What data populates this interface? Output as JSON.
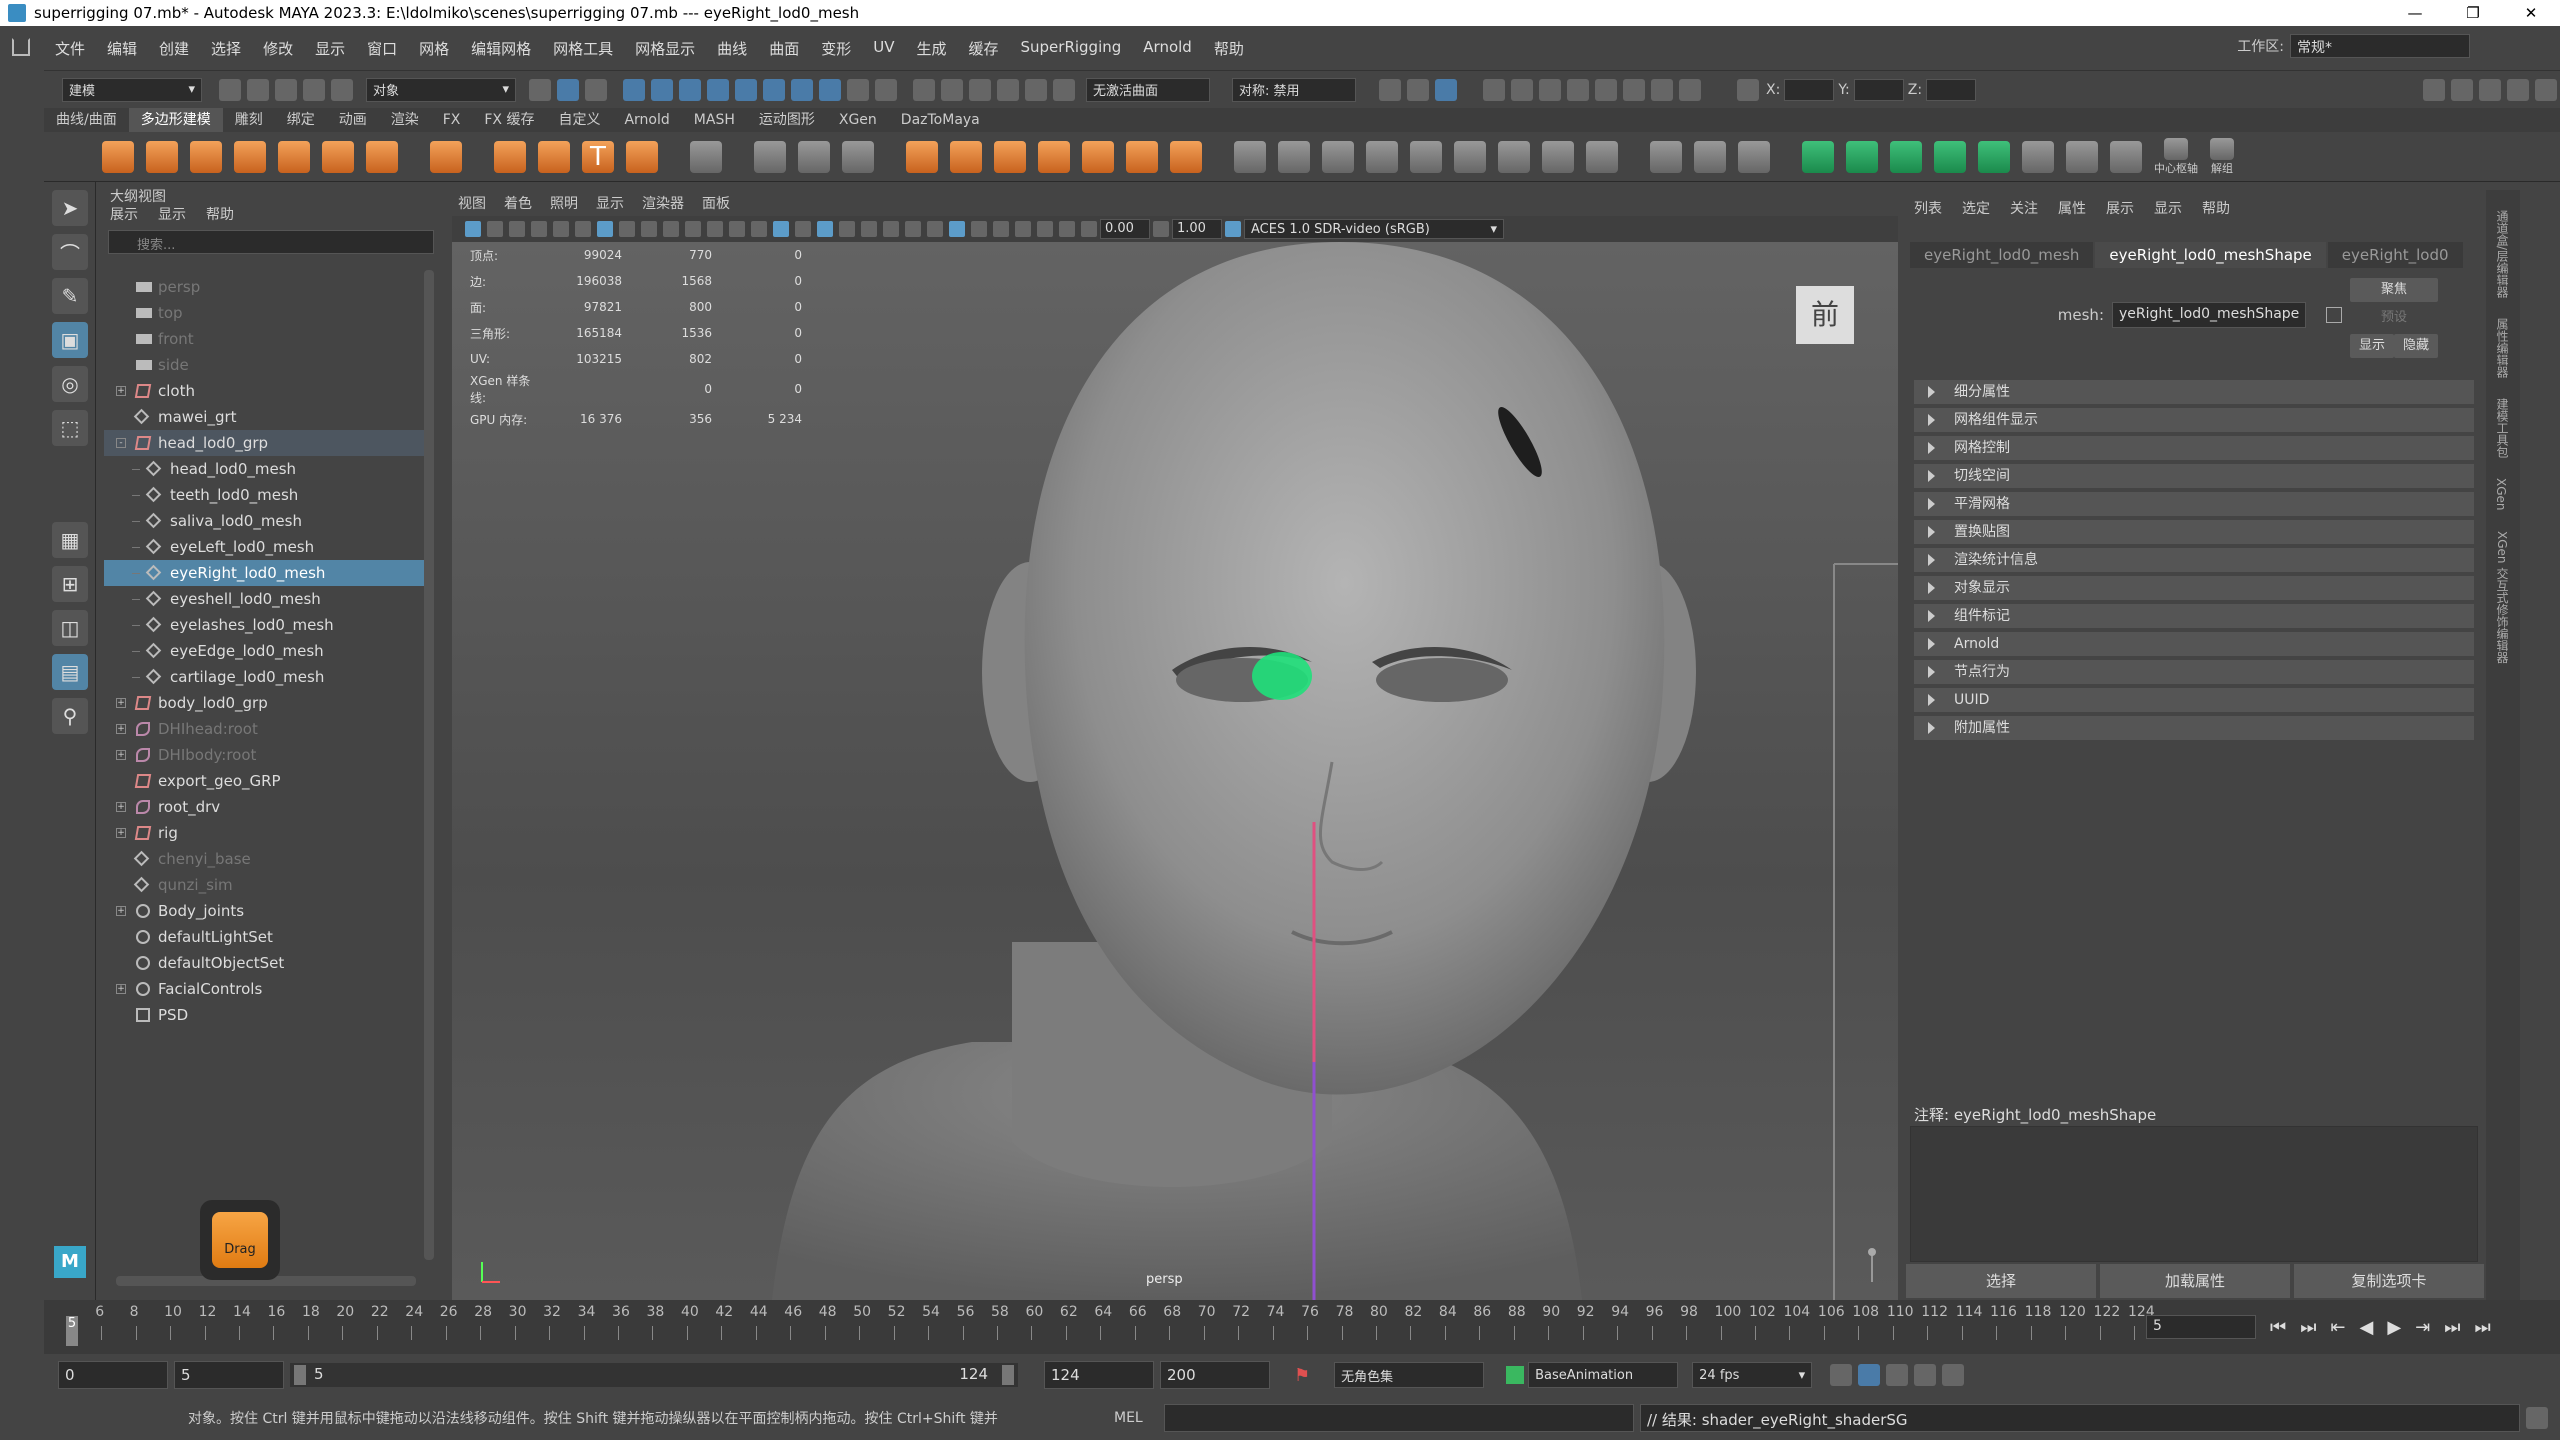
{
  "window": {
    "title": "superrigging 07.mb* - Autodesk MAYA 2023.3: E:\\ldolmiko\\scenes\\superrigging 07.mb  ---  eyeRight_lod0_mesh"
  },
  "menubar": {
    "items": [
      "文件",
      "编辑",
      "创建",
      "选择",
      "修改",
      "显示",
      "窗口",
      "网格",
      "编辑网格",
      "网格工具",
      "网格显示",
      "曲线",
      "曲面",
      "变形",
      "UV",
      "生成",
      "缓存",
      "SuperRigging",
      "Arnold",
      "帮助"
    ],
    "workspace_label": "工作区:",
    "workspace_value": "常规*"
  },
  "statusline": {
    "mode": "建模",
    "object_label": "对象",
    "live_surface": "无激活曲面",
    "symmetry": "对称: 禁用",
    "x_label": "X:",
    "y_label": "Y:",
    "z_label": "Z:"
  },
  "shelf": {
    "tabs": [
      "曲线/曲面",
      "多边形建模",
      "雕刻",
      "绑定",
      "动画",
      "渲染",
      "FX",
      "FX 缓存",
      "自定义",
      "Arnold",
      "MASH",
      "运动图形",
      "XGen",
      "DazToMaya"
    ],
    "active_tab": "多边形建模",
    "center_pivot": "中心枢轴",
    "ungroup": "解组"
  },
  "outliner": {
    "title": "大纲视图",
    "menu": [
      "展示",
      "显示",
      "帮助"
    ],
    "search_placeholder": "搜索...",
    "items": [
      {
        "label": "persp",
        "icon": "cam",
        "indent": 0,
        "dim": true
      },
      {
        "label": "top",
        "icon": "cam",
        "indent": 0,
        "dim": true
      },
      {
        "label": "front",
        "icon": "cam",
        "indent": 0,
        "dim": true
      },
      {
        "label": "side",
        "icon": "cam",
        "indent": 0,
        "dim": true
      },
      {
        "label": "cloth",
        "icon": "grp",
        "indent": 0,
        "exp": "+"
      },
      {
        "label": "mawei_grt",
        "icon": "mesh",
        "indent": 0
      },
      {
        "label": "head_lod0_grp",
        "icon": "grp",
        "indent": 0,
        "exp": "-",
        "hl": true
      },
      {
        "label": "head_lod0_mesh",
        "icon": "mesh",
        "indent": 1
      },
      {
        "label": "teeth_lod0_mesh",
        "icon": "mesh",
        "indent": 1
      },
      {
        "label": "saliva_lod0_mesh",
        "icon": "mesh",
        "indent": 1
      },
      {
        "label": "eyeLeft_lod0_mesh",
        "icon": "mesh",
        "indent": 1
      },
      {
        "label": "eyeRight_lod0_mesh",
        "icon": "mesh",
        "indent": 1,
        "sel": true
      },
      {
        "label": "eyeshell_lod0_mesh",
        "icon": "mesh",
        "indent": 1
      },
      {
        "label": "eyelashes_lod0_mesh",
        "icon": "mesh",
        "indent": 1
      },
      {
        "label": "eyeEdge_lod0_mesh",
        "icon": "mesh",
        "indent": 1
      },
      {
        "label": "cartilage_lod0_mesh",
        "icon": "mesh",
        "indent": 1
      },
      {
        "label": "body_lod0_grp",
        "icon": "grp",
        "indent": 0,
        "exp": "+"
      },
      {
        "label": "DHIhead:root",
        "icon": "joint",
        "indent": 0,
        "exp": "+",
        "dim": true
      },
      {
        "label": "DHIbody:root",
        "icon": "joint",
        "indent": 0,
        "exp": "+",
        "dim": true
      },
      {
        "label": "export_geo_GRP",
        "icon": "grp",
        "indent": 0
      },
      {
        "label": "root_drv",
        "icon": "joint",
        "indent": 0,
        "exp": "+"
      },
      {
        "label": "rig",
        "icon": "grp",
        "indent": 0,
        "exp": "+"
      },
      {
        "label": "chenyi_base",
        "icon": "mesh",
        "indent": 0,
        "dim": true
      },
      {
        "label": "qunzi_sim",
        "icon": "mesh",
        "indent": 0,
        "dim": true
      },
      {
        "label": "Body_joints",
        "icon": "set",
        "indent": 0,
        "exp": "+"
      },
      {
        "label": "defaultLightSet",
        "icon": "set",
        "indent": 0
      },
      {
        "label": "defaultObjectSet",
        "icon": "set",
        "indent": 0
      },
      {
        "label": "FacialControls",
        "icon": "set",
        "indent": 0,
        "exp": "+"
      },
      {
        "label": "PSD",
        "icon": "psd",
        "indent": 0
      }
    ],
    "drag_label": "Drag"
  },
  "viewport": {
    "menu": [
      "视图",
      "着色",
      "照明",
      "显示",
      "渲染器",
      "面板"
    ],
    "field1": "0.00",
    "field2": "1.00",
    "colorspace": "ACES 1.0 SDR-video (sRGB)",
    "view_label": "前",
    "persp_label": "persp",
    "hud": [
      {
        "k": "顶点:",
        "a": "99024",
        "b": "770",
        "c": "0"
      },
      {
        "k": "边:",
        "a": "196038",
        "b": "1568",
        "c": "0"
      },
      {
        "k": "面:",
        "a": "97821",
        "b": "800",
        "c": "0"
      },
      {
        "k": "三角形:",
        "a": "165184",
        "b": "1536",
        "c": "0"
      },
      {
        "k": "UV:",
        "a": "103215",
        "b": "802",
        "c": "0"
      },
      {
        "k": "XGen 样条线:",
        "a": "",
        "b": "0",
        "c": "0"
      },
      {
        "k": "GPU 内存:",
        "a": "16 376",
        "b": "356",
        "c": "5 234"
      }
    ]
  },
  "attr": {
    "menu": [
      "列表",
      "选定",
      "关注",
      "属性",
      "展示",
      "显示",
      "帮助"
    ],
    "tabs": [
      "eyeRight_lod0_mesh",
      "eyeRight_lod0_meshShape",
      "eyeRight_lod0"
    ],
    "mesh_label": "mesh:",
    "mesh_value": "yeRight_lod0_meshShape",
    "focus_btn": "聚焦",
    "preset_btn": "预设",
    "show_btn": "显示",
    "hide_btn": "隐藏",
    "sections": [
      "细分属性",
      "网格组件显示",
      "网格控制",
      "切线空间",
      "平滑网格",
      "置换贴图",
      "渲染统计信息",
      "对象显示",
      "组件标记",
      "Arnold",
      "节点行为",
      "UUID",
      "附加属性"
    ],
    "notes_label": "注释: eyeRight_lod0_meshShape",
    "buttons": [
      "选择",
      "加载属性",
      "复制选项卡"
    ]
  },
  "timeline": {
    "ticks": [
      5,
      6,
      8,
      10,
      12,
      14,
      16,
      18,
      20,
      22,
      24,
      26,
      28,
      30,
      32,
      34,
      36,
      38,
      40,
      42,
      44,
      46,
      48,
      50,
      52,
      54,
      56,
      58,
      60,
      62,
      64,
      66,
      68,
      70,
      72,
      74,
      76,
      78,
      80,
      82,
      84,
      86,
      88,
      90,
      92,
      94,
      96,
      98,
      100,
      102,
      104,
      106,
      108,
      110,
      112,
      114,
      116,
      118,
      120,
      122,
      124
    ],
    "current": "5",
    "frame_field": "5"
  },
  "range": {
    "start": "0",
    "start2": "5",
    "slider_left": "5",
    "slider_right": "124",
    "end": "124",
    "end2": "200",
    "charset": "无角色集",
    "anim_layer": "BaseAnimation",
    "fps": "24 fps"
  },
  "cmdline": {
    "help": "对象。按住 Ctrl 键并用鼠标中键拖动以沿法线移动组件。按住 Shift 键并拖动操纵器以在平面控制柄内拖动。按住 Ctrl+Shift 键并",
    "lang": "MEL",
    "result": "// 结果: shader_eyeRight_shaderSG"
  }
}
